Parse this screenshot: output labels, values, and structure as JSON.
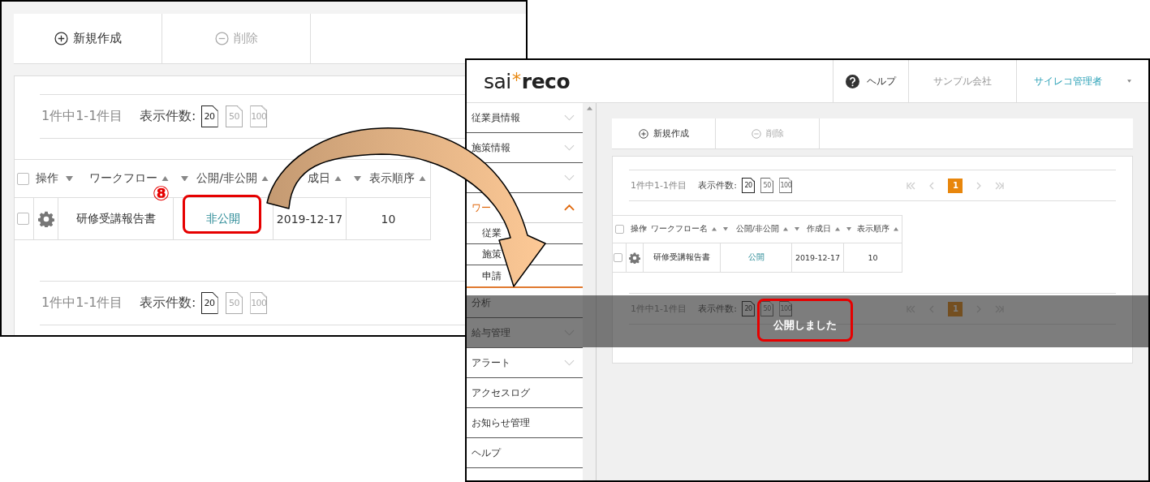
{
  "left_screen": {
    "toolbar": [
      {
        "kind": "add",
        "label": "新規作成",
        "disabled": false
      },
      {
        "kind": "remove",
        "label": "削除",
        "disabled": true
      }
    ],
    "pager_top": {
      "summary": "1件中1-1件目",
      "per_page_label": "表示件数:",
      "sizes": [
        {
          "label": "20",
          "selected": true
        },
        {
          "label": "50",
          "selected": false
        },
        {
          "label": "100",
          "selected": false
        }
      ]
    },
    "table": {
      "columns": [
        "操作",
        "ワークフロー",
        "公開/非公開",
        "成日",
        "表示順序"
      ],
      "all_checked": false,
      "rows": [
        {
          "checked": false,
          "name": "研修受講報告書",
          "visibility": "非公開",
          "date": "2019-12-17",
          "order": "10"
        }
      ]
    },
    "pager_bottom": {
      "summary": "1件中1-1件目",
      "per_page_label": "表示件数:",
      "sizes": [
        {
          "label": "20",
          "selected": true
        },
        {
          "label": "50",
          "selected": false
        },
        {
          "label": "100",
          "selected": false
        }
      ]
    }
  },
  "step_badge": "⑧",
  "right_screen": {
    "header": {
      "logo_left": "sai",
      "logo_right": "reco",
      "help": "ヘルプ",
      "company": "サンプル会社",
      "user": "サイレコ管理者"
    },
    "sidebar": [
      {
        "label": "従業員情報",
        "kind": "group",
        "expanded": false
      },
      {
        "label": "施策情報",
        "kind": "group",
        "expanded": false
      },
      {
        "kind": "group",
        "expanded": false
      },
      {
        "label": "ワー",
        "kind": "group",
        "expanded": true,
        "children": [
          {
            "label": "従業"
          },
          {
            "label": "施策"
          },
          {
            "label": "申請"
          }
        ]
      },
      {
        "label": "分析",
        "kind": "link"
      },
      {
        "label": "給与管理",
        "kind": "group",
        "expanded": false
      },
      {
        "label": "アラート",
        "kind": "group",
        "expanded": false
      },
      {
        "label": "アクセスログ",
        "kind": "link"
      },
      {
        "label": "お知らせ管理",
        "kind": "link"
      },
      {
        "label": "ヘルプ",
        "kind": "link"
      }
    ],
    "toolbar": [
      {
        "kind": "add",
        "label": "新規作成",
        "disabled": false
      },
      {
        "kind": "remove",
        "label": "削除",
        "disabled": true
      }
    ],
    "pager_top": {
      "summary": "1件中1-1件目",
      "per_page_label": "表示件数:",
      "sizes": [
        {
          "label": "20",
          "selected": true
        },
        {
          "label": "50",
          "selected": false
        },
        {
          "label": "100",
          "selected": false
        }
      ],
      "pages": [
        {
          "label": "1",
          "selected": true
        }
      ]
    },
    "table": {
      "columns": [
        "操作",
        "ワークフロー名",
        "公開/非公開",
        "作成日",
        "表示順序"
      ],
      "all_checked": false,
      "rows": [
        {
          "checked": false,
          "name": "研修受講報告書",
          "visibility": "公開",
          "date": "2019-12-17",
          "order": "10"
        }
      ]
    },
    "pager_bottom": {
      "summary": "1件中1-1件目",
      "per_page_label": "表示件数:",
      "sizes": [
        {
          "label": "20",
          "selected": true
        },
        {
          "label": "50",
          "selected": false
        },
        {
          "label": "100",
          "selected": false
        }
      ],
      "pages": [
        {
          "label": "1",
          "selected": true
        }
      ]
    },
    "toast": "公開しました"
  }
}
